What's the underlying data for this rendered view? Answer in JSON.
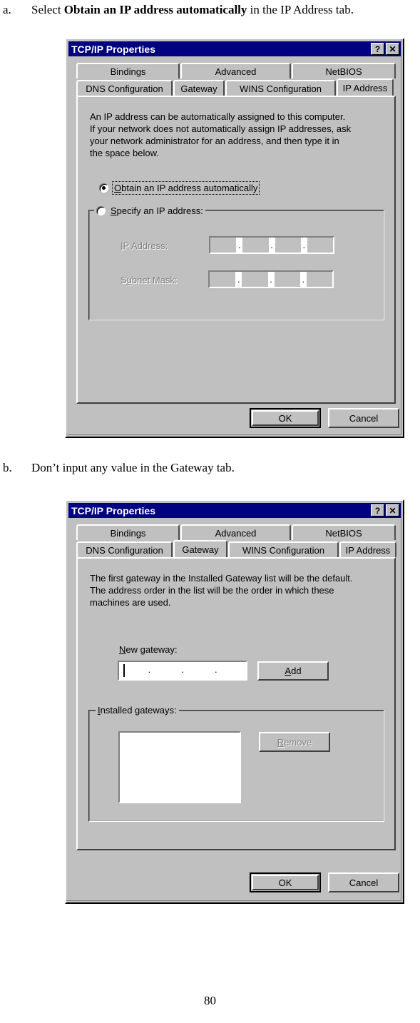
{
  "document": {
    "steps": [
      {
        "marker": "a.",
        "text_before": "Select ",
        "bold": "Obtain an IP address automatically",
        "text_after": " in the IP Address tab."
      },
      {
        "marker": "b.",
        "text_before": "Don’t input any value in the Gateway tab.",
        "bold": "",
        "text_after": ""
      }
    ],
    "page_number": "80"
  },
  "colors": {
    "titlebar": "#000080",
    "titlebar_text": "#ffffff",
    "dialog_face": "#c0c0c0",
    "disabled_text": "#808080",
    "text": "#000000",
    "field_white": "#ffffff"
  },
  "dialog_ip": {
    "title": "TCP/IP Properties",
    "help_button": "?",
    "close_button": "✕",
    "tabs_row1": [
      {
        "label": "Bindings",
        "selected": false
      },
      {
        "label": "Advanced",
        "selected": false
      },
      {
        "label": "NetBIOS",
        "selected": false
      }
    ],
    "tabs_row2": [
      {
        "label": "DNS Configuration",
        "selected": false
      },
      {
        "label": "Gateway",
        "selected": false
      },
      {
        "label": "WINS Configuration",
        "selected": false
      },
      {
        "label": "IP Address",
        "selected": true
      }
    ],
    "description": "An IP address can be automatically assigned to this computer.\nIf your network does not automatically assign IP addresses, ask\nyour network administrator for an address, and then type it in\nthe space below.",
    "radio_auto": {
      "label_accel": "O",
      "label_rest": "btain an IP address automatically",
      "checked": true,
      "focused": true
    },
    "radio_specify": {
      "label_accel": "S",
      "label_rest": "pecify an IP address:",
      "checked": false
    },
    "ip_address_label_accel": "I",
    "ip_address_label_rest": "P Address:",
    "subnet_mask_label_accel": "S",
    "subnet_mask_label_pre": "u",
    "subnet_mask_label_rest": "bnet Mask:",
    "ip_address_value": [
      "",
      "",
      "",
      ""
    ],
    "subnet_mask_value": [
      "",
      "",
      "",
      ""
    ],
    "ip_separator": ".",
    "ok_label": "OK",
    "cancel_label": "Cancel"
  },
  "dialog_gw": {
    "title": "TCP/IP Properties",
    "help_button": "?",
    "close_button": "✕",
    "tabs_row1": [
      {
        "label": "Bindings",
        "selected": false
      },
      {
        "label": "Advanced",
        "selected": false
      },
      {
        "label": "NetBIOS",
        "selected": false
      }
    ],
    "tabs_row2": [
      {
        "label": "DNS Configuration",
        "selected": false
      },
      {
        "label": "Gateway",
        "selected": true
      },
      {
        "label": "WINS Configuration",
        "selected": false
      },
      {
        "label": "IP Address",
        "selected": false
      }
    ],
    "description": "The first gateway in the Installed Gateway list will be the default.\nThe address order in the list will be the order in which these\nmachines are used.",
    "new_gateway_label_accel": "N",
    "new_gateway_label_rest": "ew gateway:",
    "new_gateway_value": [
      "",
      "",
      "",
      ""
    ],
    "ip_separator": ".",
    "add_button_accel": "A",
    "add_button_rest": "dd",
    "installed_gateways_legend_accel": "I",
    "installed_gateways_legend_rest": "nstalled gateways:",
    "installed_gateways_items": [],
    "remove_button_accel": "R",
    "remove_button_rest": "emove",
    "remove_enabled": false,
    "ok_label": "OK",
    "cancel_label": "Cancel"
  }
}
